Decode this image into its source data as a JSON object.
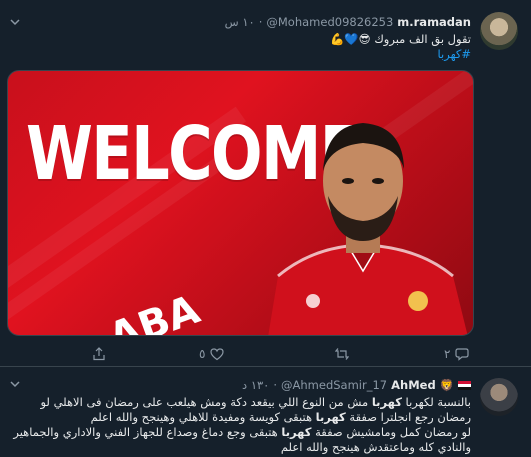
{
  "tweets": [
    {
      "author": {
        "name": "m.ramadan",
        "handle": "@Mohamed09826253"
      },
      "time": "١٠ س",
      "text_line1": "تقول بق الف مبروك 😎💙💪",
      "hashtag": "#كهربا",
      "media": {
        "headline": "WELCOME",
        "fragment": "ABA"
      },
      "actions": {
        "reply_count": "٢",
        "retweet_count": "",
        "like_count": "٥"
      }
    },
    {
      "author": {
        "name": "AhMed",
        "handle": "@AhmedSamir_17",
        "emoji": "🦁"
      },
      "time": "١٣٠ د",
      "lines": [
        {
          "pre": "بالنسبة لكهربا ",
          "bold": "كهربا",
          "post": " مش من النوع اللي بيقعد دكة ومش هيلعب على رمضان فى الاهلي لو"
        },
        {
          "pre": "رمضان رجع انجلترا صفقة ",
          "bold": "كهربا",
          "post": " هتبقى كويسة ومفيدة للاهلي وهينجح والله اعلم"
        },
        {
          "pre": "لو رمضان كمل ومامشيش صفقة ",
          "bold": "كهربا",
          "post": " هتبقى وجع دماغ وصداع للجهاز الفني والاداري والجماهير"
        },
        {
          "pre": "والنادي كله وماعتقدش هينجح والله اعلم",
          "bold": "",
          "post": ""
        }
      ]
    }
  ]
}
